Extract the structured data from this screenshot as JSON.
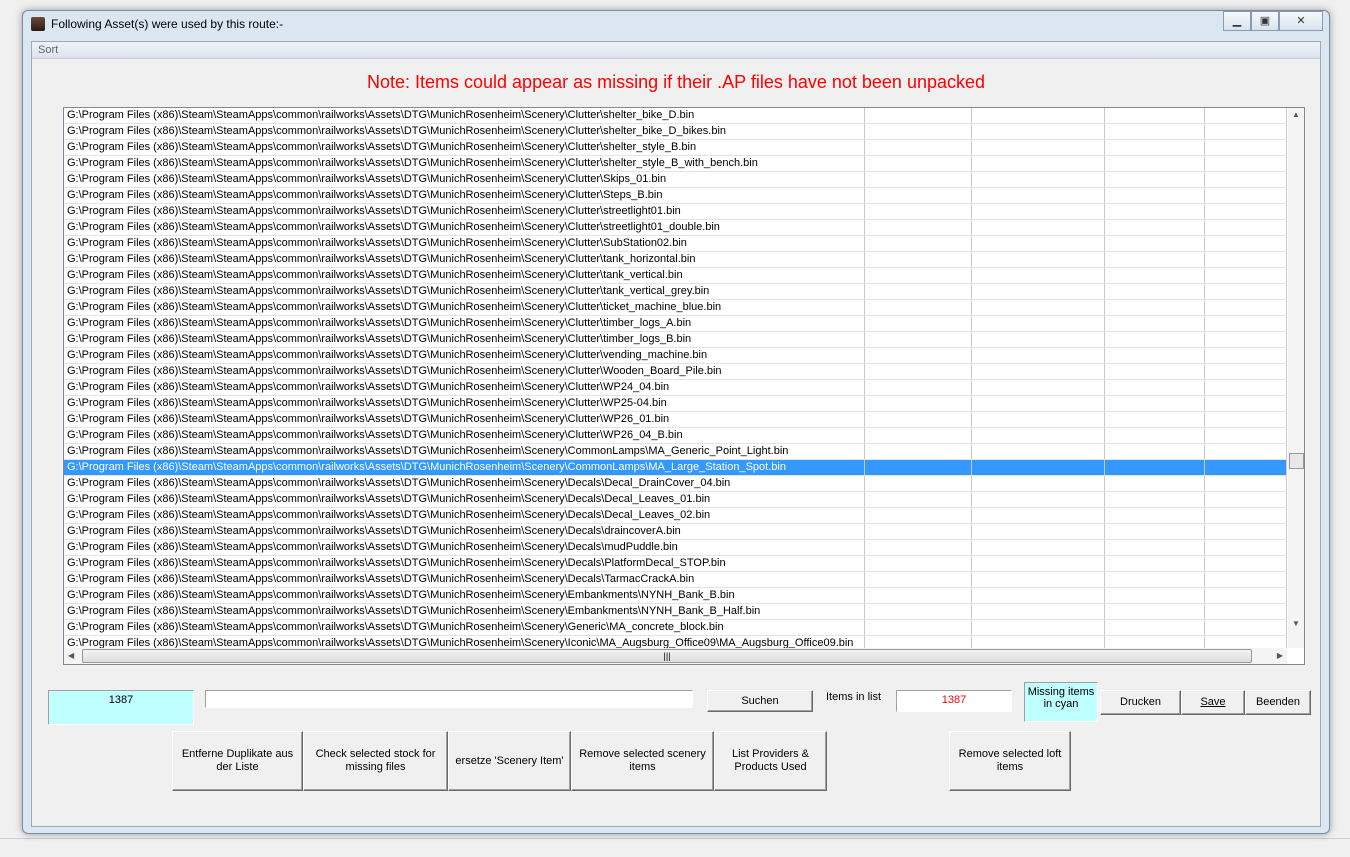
{
  "window": {
    "title": "Following Asset(s) were used by this route:-",
    "menu": [
      "Sort"
    ]
  },
  "note": "Note: Items could appear as missing if their .AP files have not been unpacked",
  "list": {
    "prefix": "G:\\Program Files (x86)\\Steam\\SteamApps\\common\\railworks\\Assets\\DTG\\MunichRosenheim\\Scenery\\",
    "selected_index": 22,
    "rows": [
      "Clutter\\shelter_bike_D.bin",
      "Clutter\\shelter_bike_D_bikes.bin",
      "Clutter\\shelter_style_B.bin",
      "Clutter\\shelter_style_B_with_bench.bin",
      "Clutter\\Skips_01.bin",
      "Clutter\\Steps_B.bin",
      "Clutter\\streetlight01.bin",
      "Clutter\\streetlight01_double.bin",
      "Clutter\\SubStation02.bin",
      "Clutter\\tank_horizontal.bin",
      "Clutter\\tank_vertical.bin",
      "Clutter\\tank_vertical_grey.bin",
      "Clutter\\ticket_machine_blue.bin",
      "Clutter\\timber_logs_A.bin",
      "Clutter\\timber_logs_B.bin",
      "Clutter\\vending_machine.bin",
      "Clutter\\Wooden_Board_Pile.bin",
      "Clutter\\WP24_04.bin",
      "Clutter\\WP25-04.bin",
      "Clutter\\WP26_01.bin",
      "Clutter\\WP26_04_B.bin",
      "CommonLamps\\MA_Generic_Point_Light.bin",
      "CommonLamps\\MA_Large_Station_Spot.bin",
      "Decals\\Decal_DrainCover_04.bin",
      "Decals\\Decal_Leaves_01.bin",
      "Decals\\Decal_Leaves_02.bin",
      "Decals\\draincoverA.bin",
      "Decals\\mudPuddle.bin",
      "Decals\\PlatformDecal_STOP.bin",
      "Decals\\TarmacCrackA.bin",
      "Embankments\\NYNH_Bank_B.bin",
      "Embankments\\NYNH_Bank_B_Half.bin",
      "Generic\\MA_concrete_block.bin",
      "Iconic\\MA_Augsburg_Office09\\MA_Augsburg_Office09.bin"
    ]
  },
  "counter_cyan": "1387",
  "search": {
    "value": "",
    "button": "Suchen"
  },
  "items_in_list": {
    "label": "Items in list",
    "value": "1387"
  },
  "legend": "Missing items in cyan",
  "buttons": {
    "print": "Drucken",
    "save": "Save",
    "exit": "Beenden",
    "dedupe": "Entferne Duplikate aus der Liste",
    "check": "Check selected stock for missing files",
    "replace": "ersetze 'Scenery Item'",
    "remove_scenery": "Remove selected scenery items",
    "providers": "List Providers & Products Used",
    "remove_loft": "Remove selected loft items"
  },
  "colors": {
    "cyan": "#c0ffff",
    "selection": "#3399ff",
    "note": "#ff0000"
  }
}
